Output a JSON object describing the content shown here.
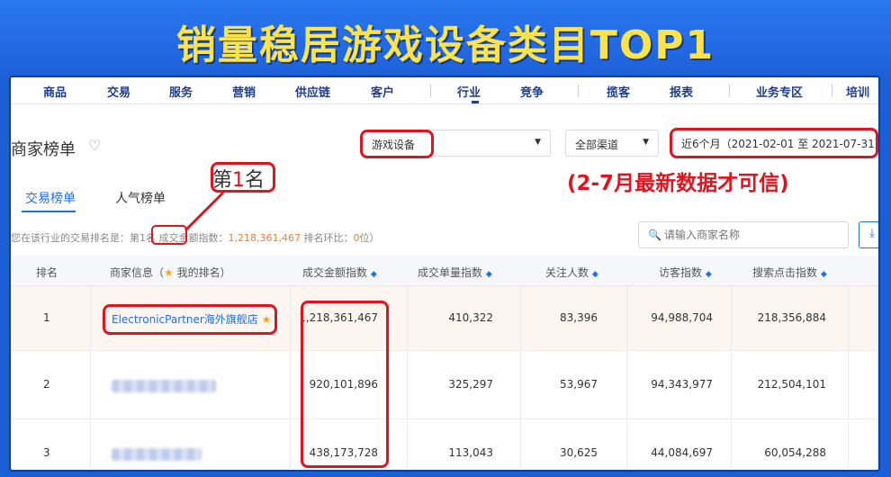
{
  "banner": {
    "title": "销量稳居游戏设备类目TOP1"
  },
  "nav": {
    "items": [
      "商品",
      "交易",
      "服务",
      "营销",
      "供应链",
      "客户",
      "行业",
      "竞争",
      "揽客",
      "报表",
      "业务专区",
      "培训"
    ],
    "active": "行业"
  },
  "page": {
    "title": "商家榜单"
  },
  "filters": {
    "category": "游戏设备",
    "channel": "全部渠道",
    "date_range": "近6个月（2021-02-01 至 2021-07-31）"
  },
  "annotation": {
    "text": "(2-7月最新数据才可信)"
  },
  "callout": {
    "prefix": "第",
    "number": "1",
    "suffix": "名"
  },
  "tabs": [
    "交易榜单",
    "人气榜单"
  ],
  "info": {
    "prefix": "您在该行业的交易排名是：",
    "rank": "第1名",
    "gmv_label": "成交金额指数：",
    "gmv_value": "1,218,361,467",
    "change_label": "排名环比：",
    "change_value": "0",
    "change_suffix": "位）"
  },
  "search": {
    "placeholder": "请输入商家名称"
  },
  "table": {
    "headers": {
      "rank": "排名",
      "shop": "商家信息（",
      "shop_suffix": "我的排名）",
      "gmv": "成交金额指数",
      "orders": "成交单量指数",
      "followers": "关注人数",
      "visitors": "访客指数",
      "search_clicks": "搜索点击指数"
    },
    "rows": [
      {
        "rank": "1",
        "shop": "ElectronicPartner海外旗舰店",
        "gmv": "1,218,361,467",
        "orders": "410,322",
        "followers": "83,396",
        "visitors": "94,988,704",
        "search_clicks": "218,356,884"
      },
      {
        "rank": "2",
        "shop": "",
        "gmv": "920,101,896",
        "orders": "325,297",
        "followers": "53,967",
        "visitors": "94,343,977",
        "search_clicks": "212,504,101"
      },
      {
        "rank": "3",
        "shop": "",
        "gmv": "438,173,728",
        "orders": "113,043",
        "followers": "30,625",
        "visitors": "44,084,697",
        "search_clicks": "60,054,288"
      }
    ]
  },
  "colors": {
    "accent": "#1d6ff2",
    "highlight": "#e0141e",
    "banner_text": "#ffe34a",
    "nav_text": "#1d3f8f"
  }
}
